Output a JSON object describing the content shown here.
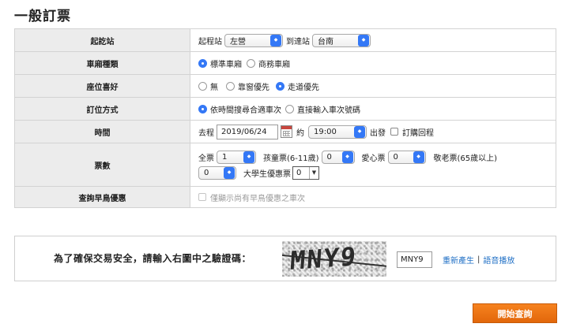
{
  "page": {
    "title": "一般訂票"
  },
  "rows": {
    "station": {
      "label": "起訖站",
      "from_label": "起程站",
      "from_value": "左營",
      "to_label": "到達站",
      "to_value": "台南"
    },
    "car_type": {
      "label": "車廂種類",
      "options": [
        "標準車廂",
        "商務車廂"
      ],
      "selected": "標準車廂"
    },
    "seat_pref": {
      "label": "座位喜好",
      "options": [
        "無",
        "靠窗優先",
        "走道優先"
      ],
      "selected": "走道優先"
    },
    "booking_method": {
      "label": "訂位方式",
      "options": [
        "依時間搜尋合適車次",
        "直接輸入車次號碼"
      ],
      "selected": "依時間搜尋合適車次"
    },
    "time": {
      "label": "時間",
      "outbound_label": "去程",
      "date": "2019/06/24",
      "about_label": "約",
      "time_value": "19:00",
      "depart_label": "出發",
      "return_label": "訂購回程",
      "return_checked": false
    },
    "tickets": {
      "label": "票數",
      "full_label": "全票",
      "full_value": "1",
      "child_label": "孩童票(6-11歲)",
      "child_value": "0",
      "disabled_label": "愛心票",
      "disabled_value": "0",
      "senior_label": "敬老票(65歲以上)",
      "senior_value": "0",
      "student_label": "大學生優惠票",
      "student_value": "0"
    },
    "early_bird": {
      "label": "查詢早鳥優惠",
      "checkbox_label": "僅顯示尚有早鳥優惠之車次",
      "checked": false
    }
  },
  "captcha": {
    "prompt": "為了確保交易安全，請輸入右圖中之驗證碼：",
    "image_text": "MNY9",
    "input_value": "MNY9",
    "regenerate": "重新產生",
    "separator": "|",
    "audio": "語音播放"
  },
  "search_button": "開始查詢",
  "colors": {
    "accent": "#3478f6",
    "button": "#f6821f",
    "link": "#1f6fc5",
    "label_bg": "#ececec"
  }
}
